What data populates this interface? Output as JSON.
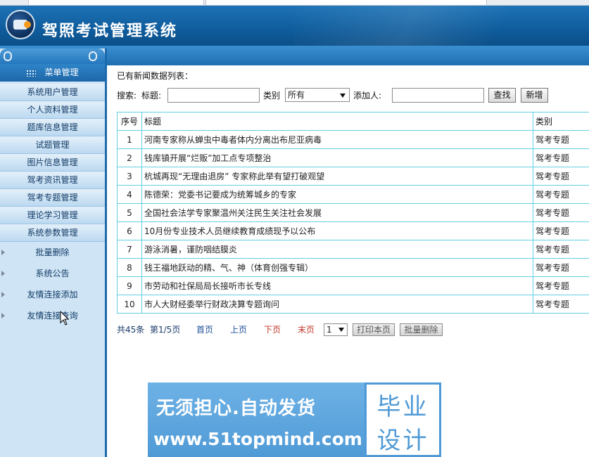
{
  "app": {
    "title": "驾照考试管理系统"
  },
  "sidebar": {
    "menu_header": "菜单管理",
    "items": [
      {
        "label": "系统用户管理"
      },
      {
        "label": "个人资料管理"
      },
      {
        "label": "题库信息管理"
      },
      {
        "label": "试题管理"
      },
      {
        "label": "图片信息管理"
      },
      {
        "label": "驾考资讯管理"
      },
      {
        "label": "驾考专题管理"
      },
      {
        "label": "理论学习管理"
      },
      {
        "label": "系统参数管理"
      }
    ],
    "subitems": [
      {
        "label": "批量删除"
      },
      {
        "label": "系统公告"
      },
      {
        "label": "友情连接添加"
      },
      {
        "label": "友情连接查询"
      }
    ]
  },
  "main": {
    "list_title": "已有新闻数据列表：",
    "search": {
      "search_label": "搜索:",
      "title_label": "标题:",
      "title_value": "",
      "category_label": "类别",
      "category_selected": "所有",
      "adder_label": "添加人:",
      "adder_value": "",
      "search_button": "查找",
      "add_button": "新增"
    },
    "table": {
      "headers": {
        "no": "序号",
        "title": "标题",
        "category": "类别"
      },
      "rows": [
        {
          "no": "1",
          "title": "河南专家称从蝉虫中毒者体内分离出布尼亚病毒",
          "category": "驾考专题"
        },
        {
          "no": "2",
          "title": "钱库镇开展“烂贩”加工点专项整治",
          "category": "驾考专题"
        },
        {
          "no": "3",
          "title": "杭城再现“无理由退房” 专家称此举有望打破观望",
          "category": "驾考专题"
        },
        {
          "no": "4",
          "title": "陈德荣：党委书记要成为统筹城乡的专家",
          "category": "驾考专题"
        },
        {
          "no": "5",
          "title": "全国社会法学专家聚温州关注民生关注社会发展",
          "category": "驾考专题"
        },
        {
          "no": "6",
          "title": "10月份专业技术人员继续教育成绩现予以公布",
          "category": "驾考专题"
        },
        {
          "no": "7",
          "title": "游泳消暑，谨防咽结膜炎",
          "category": "驾考专题"
        },
        {
          "no": "8",
          "title": "钱王福地跃动的精、气、神（体育创强专辑）",
          "category": "驾考专题"
        },
        {
          "no": "9",
          "title": "市劳动和社保局局长接听市长专线",
          "category": "驾考专题"
        },
        {
          "no": "10",
          "title": "市人大财经委举行财政决算专题询问",
          "category": "驾考专题"
        }
      ]
    },
    "pager": {
      "total": "共45条",
      "page_info": "第1/5页",
      "first": "首页",
      "prev": "上页",
      "next": "下页",
      "last": "末页",
      "page_select": "1",
      "print_button": "打印本页",
      "batch_delete_button": "批量删除"
    }
  },
  "watermark": {
    "line1": "无须担心.自动发货",
    "line2": "www.51topmind.com",
    "right1": "毕业",
    "right2": "设计"
  },
  "colors": {
    "header_blue": "#0f5c9c",
    "sidebar_bg": "#cfe5f5",
    "table_border": "#62cfe2",
    "link_blue": "#1f4e98",
    "link_red": "#c0392b",
    "logo_orange": "#f39a1f"
  },
  "icons": [
    "app-logo-icon",
    "menu-grid-icon",
    "arrow-bullet-icon",
    "mouse-cursor-icon",
    "dropdown-arrow-icon"
  ]
}
